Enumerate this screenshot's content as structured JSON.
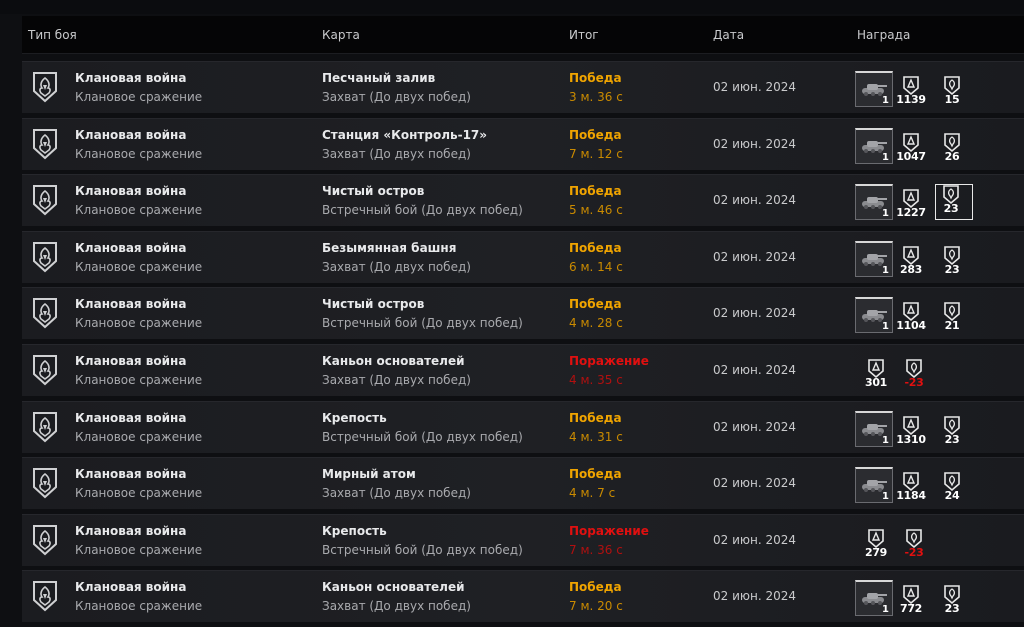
{
  "table": {
    "headers": {
      "battle_type": "Тип боя",
      "map": "Карта",
      "result": "Итог",
      "date": "Дата",
      "reward": "Награда"
    },
    "rows": [
      {
        "type": "Клановая война",
        "subtype": "Клановое сражение",
        "map": "Песчаный залив",
        "mode": "Захват (До двух побед)",
        "result": "Победа",
        "duration": "3 м. 36 с",
        "won": true,
        "date": "02 июн. 2024",
        "tank_count": "1",
        "reward_a": "1139",
        "reward_b": "15"
      },
      {
        "type": "Клановая война",
        "subtype": "Клановое сражение",
        "map": "Станция «Контроль-17»",
        "mode": "Захват (До двух побед)",
        "result": "Победа",
        "duration": "7 м. 12 с",
        "won": true,
        "date": "02 июн. 2024",
        "tank_count": "1",
        "reward_a": "1047",
        "reward_b": "26"
      },
      {
        "type": "Клановая война",
        "subtype": "Клановое сражение",
        "map": "Чистый остров",
        "mode": "Встречный бой (До двух побед)",
        "result": "Победа",
        "duration": "5 м. 46 с",
        "won": true,
        "date": "02 июн. 2024",
        "tank_count": "1",
        "reward_a": "1227",
        "reward_b": "23"
      },
      {
        "type": "Клановая война",
        "subtype": "Клановое сражение",
        "map": "Безымянная башня",
        "mode": "Захват (До двух побед)",
        "result": "Победа",
        "duration": "6 м. 14 с",
        "won": true,
        "date": "02 июн. 2024",
        "tank_count": "1",
        "reward_a": "283",
        "reward_b": "23"
      },
      {
        "type": "Клановая война",
        "subtype": "Клановое сражение",
        "map": "Чистый остров",
        "mode": "Встречный бой (До двух побед)",
        "result": "Победа",
        "duration": "4 м. 28 с",
        "won": true,
        "date": "02 июн. 2024",
        "tank_count": "1",
        "reward_a": "1104",
        "reward_b": "21"
      },
      {
        "type": "Клановая война",
        "subtype": "Клановое сражение",
        "map": "Каньон основателей",
        "mode": "Захват (До двух побед)",
        "result": "Поражение",
        "duration": "4 м. 35 с",
        "won": false,
        "date": "02 июн. 2024",
        "reward_a": "301",
        "reward_b": "-23"
      },
      {
        "type": "Клановая война",
        "subtype": "Клановое сражение",
        "map": "Крепость",
        "mode": "Встречный бой (До двух побед)",
        "result": "Победа",
        "duration": "4 м. 31 с",
        "won": true,
        "date": "02 июн. 2024",
        "tank_count": "1",
        "reward_a": "1310",
        "reward_b": "23"
      },
      {
        "type": "Клановая война",
        "subtype": "Клановое сражение",
        "map": "Мирный атом",
        "mode": "Захват (До двух побед)",
        "result": "Победа",
        "duration": "4 м. 7 с",
        "won": true,
        "date": "02 июн. 2024",
        "tank_count": "1",
        "reward_a": "1184",
        "reward_b": "24"
      },
      {
        "type": "Клановая война",
        "subtype": "Клановое сражение",
        "map": "Крепость",
        "mode": "Встречный бой (До двух побед)",
        "result": "Поражение",
        "duration": "7 м. 36 с",
        "won": false,
        "date": "02 июн. 2024",
        "reward_a": "279",
        "reward_b": "-23"
      },
      {
        "type": "Клановая война",
        "subtype": "Клановое сражение",
        "map": "Каньон основателей",
        "mode": "Захват (До двух побед)",
        "result": "Победа",
        "duration": "7 м. 20 с",
        "won": true,
        "date": "02 июн. 2024",
        "tank_count": "1",
        "reward_a": "772",
        "reward_b": "23"
      }
    ]
  },
  "icons": {
    "clan_emblem": "clan-war-emblem-icon",
    "tank": "tank-icon",
    "reward_a": "fame-points-icon",
    "reward_b": "clan-rating-icon"
  },
  "colors": {
    "win": "#f0a400",
    "loss": "#e01010",
    "background": "#0e0f12",
    "row": "#1e1f23"
  }
}
